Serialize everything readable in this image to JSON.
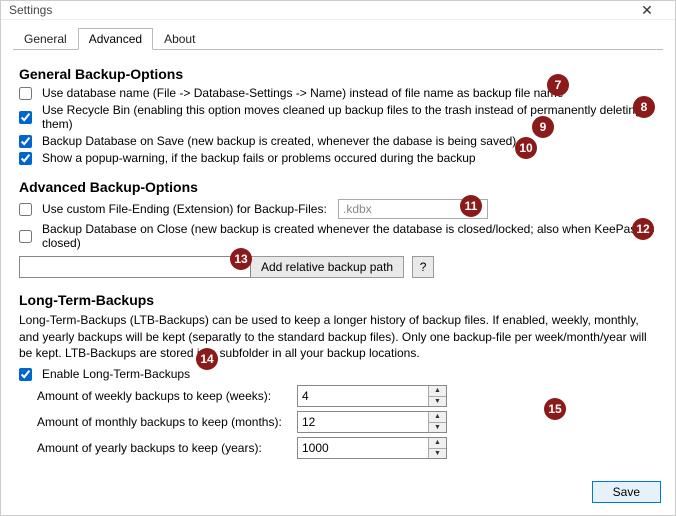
{
  "window": {
    "title": "Settings"
  },
  "tabs": {
    "general": "General",
    "advanced": "Advanced",
    "about": "About"
  },
  "general_section": {
    "heading": "General Backup-Options",
    "opt_dbname": "Use database name (File -> Database-Settings -> Name) instead of file name as backup file name",
    "opt_recycle": "Use Recycle Bin (enabling this option moves cleaned up backup files to the trash instead of permanently deleting them)",
    "opt_onsave": "Backup Database on Save (new backup is created, whenever the dabase is being saved)",
    "opt_popup": "Show a popup-warning, if the backup fails or problems occured during the backup"
  },
  "advanced_section": {
    "heading": "Advanced Backup-Options",
    "opt_ext": "Use custom File-Ending (Extension) for Backup-Files:",
    "ext_value": ".kdbx",
    "opt_onclose": "Backup Database on Close (new backup is created whenever the database is closed/locked; also when KeePass is closed)",
    "add_btn": "Add relative backup path",
    "help_btn": "?"
  },
  "ltb": {
    "heading": "Long-Term-Backups",
    "desc": "Long-Term-Backups (LTB-Backups) can be used to keep a longer history of backup files. If enabled, weekly, monthly, and yearly backups will be kept (separatly to the standard backup files). Only one backup-file per week/month/year will be kept. LTB-Backups are stored in a subfolder in all your backup locations.",
    "enable": "Enable Long-Term-Backups",
    "weekly_lbl": "Amount of weekly backups to keep (weeks):",
    "weekly_val": "4",
    "monthly_lbl": "Amount of monthly backups to keep (months):",
    "monthly_val": "12",
    "yearly_lbl": "Amount of yearly backups to keep (years):",
    "yearly_val": "1000"
  },
  "footer": {
    "save": "Save"
  },
  "badges": {
    "b7": "7",
    "b8": "8",
    "b9": "9",
    "b10": "10",
    "b11": "11",
    "b12": "12",
    "b13": "13",
    "b14": "14",
    "b15": "15"
  }
}
